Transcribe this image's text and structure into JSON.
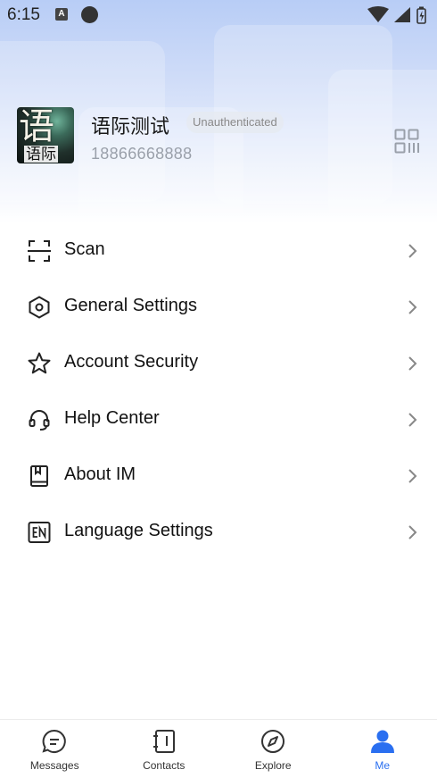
{
  "status_bar": {
    "time": "6:15",
    "notification_letter": "A"
  },
  "profile": {
    "avatar_text": "语",
    "avatar_subtext": "语际",
    "name": "语际测试",
    "badge": "Unauthenticated",
    "phone": "18866668888"
  },
  "menu": {
    "items": [
      {
        "label": "Scan",
        "icon": "scan-icon"
      },
      {
        "label": "General Settings",
        "icon": "hexagon-settings-icon"
      },
      {
        "label": "Account Security",
        "icon": "star-icon"
      },
      {
        "label": "Help Center",
        "icon": "headset-icon"
      },
      {
        "label": "About IM",
        "icon": "book-icon"
      },
      {
        "label": "Language Settings",
        "icon": "language-en-icon"
      }
    ]
  },
  "tab_bar": {
    "tabs": [
      {
        "label": "Messages",
        "icon": "chat-bubble-icon"
      },
      {
        "label": "Contacts",
        "icon": "contacts-book-icon"
      },
      {
        "label": "Explore",
        "icon": "compass-icon"
      },
      {
        "label": "Me",
        "icon": "person-icon"
      }
    ],
    "active_index": 3
  },
  "colors": {
    "accent": "#2a6ff0",
    "hero_top": "#b8cdf6",
    "badge_bg": "#e6e9f0",
    "muted_text": "#9aa0aa"
  }
}
